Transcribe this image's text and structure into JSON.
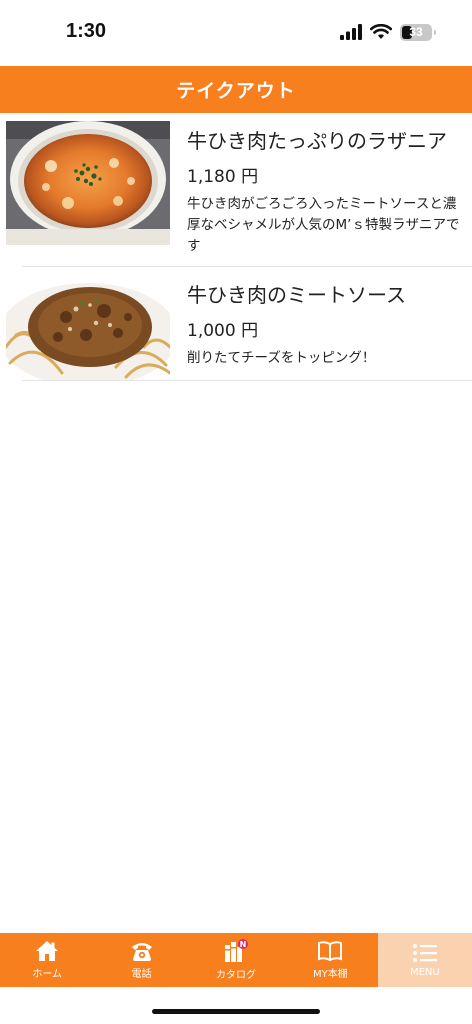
{
  "status": {
    "time": "1:30",
    "battery": "33"
  },
  "header": {
    "title": "テイクアウト"
  },
  "items": [
    {
      "title": "牛ひき肉たっぷりのラザニア",
      "price": "1,180 円",
      "description": "牛ひき肉がごろごろ入ったミートソースと濃厚なベシャメルが人気のM’ｓ特製ラザニアです",
      "image": "lasagna-photo"
    },
    {
      "title": "牛ひき肉のミートソース",
      "price": "1,000 円",
      "description": "削りたてチーズをトッピング！",
      "image": "meat-sauce-pasta-photo"
    }
  ],
  "tabbar": {
    "tabs": [
      {
        "label": "ホーム",
        "icon": "home-icon"
      },
      {
        "label": "電話",
        "icon": "phone-icon"
      },
      {
        "label": "カタログ",
        "icon": "catalog-icon",
        "badge": "N"
      },
      {
        "label": "MY本棚",
        "icon": "book-icon"
      },
      {
        "label": "MENU",
        "icon": "menu-icon"
      }
    ],
    "active": "MENU"
  },
  "colors": {
    "accent": "#f77f1e",
    "active_tab_bg": "#fbd2b0"
  }
}
